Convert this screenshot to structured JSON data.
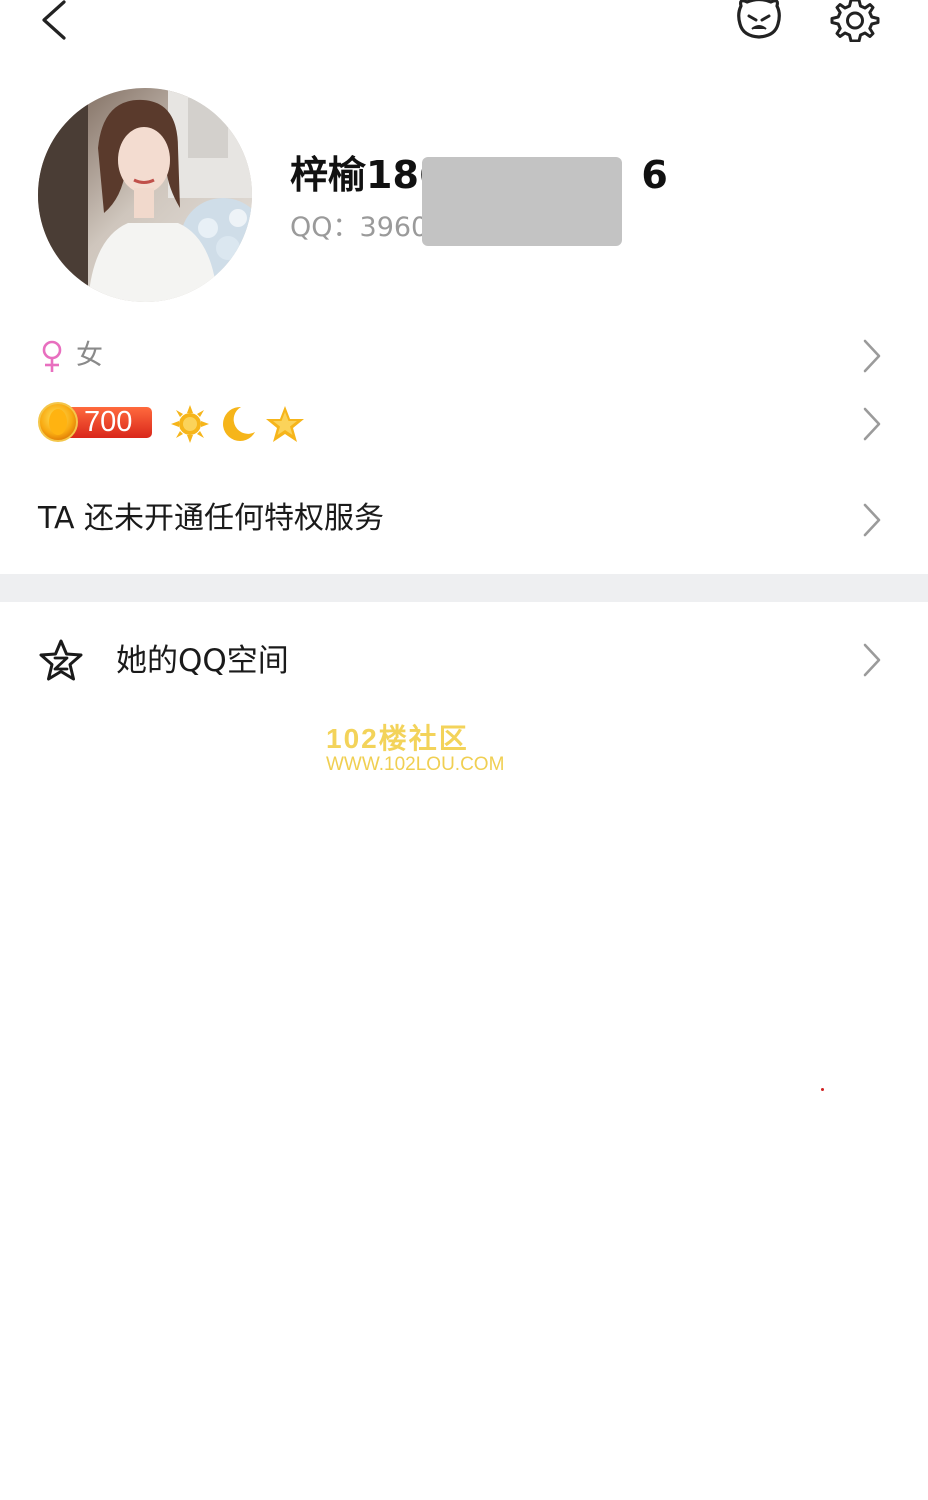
{
  "topbar": {
    "back_icon": "chevron-left-icon",
    "pet_icon": "pet-face-icon",
    "settings_icon": "gear-icon"
  },
  "profile": {
    "nickname": "梓榆186",
    "nickname_suffix": "6",
    "qq_label": "QQ：",
    "qq_number": "3960"
  },
  "gender_row": {
    "label": "女",
    "icon": "female-icon",
    "color": "#e86fbf"
  },
  "level_row": {
    "level": "700",
    "icons": [
      "crown-coin-icon",
      "sun-icon",
      "moon-icon",
      "star-icon"
    ]
  },
  "privilege_row": {
    "text": "TA 还未开通任何特权服务"
  },
  "qzone_row": {
    "label": "她的QQ空间",
    "icon": "qzone-star-icon"
  },
  "watermark": {
    "title": "102楼社区",
    "url": "WWW.102LOU.COM"
  },
  "colors": {
    "divider": "#eeeff1",
    "chevron": "#9b9b9b",
    "gold": "#f6b51a",
    "badge_red": "#e63a24"
  }
}
